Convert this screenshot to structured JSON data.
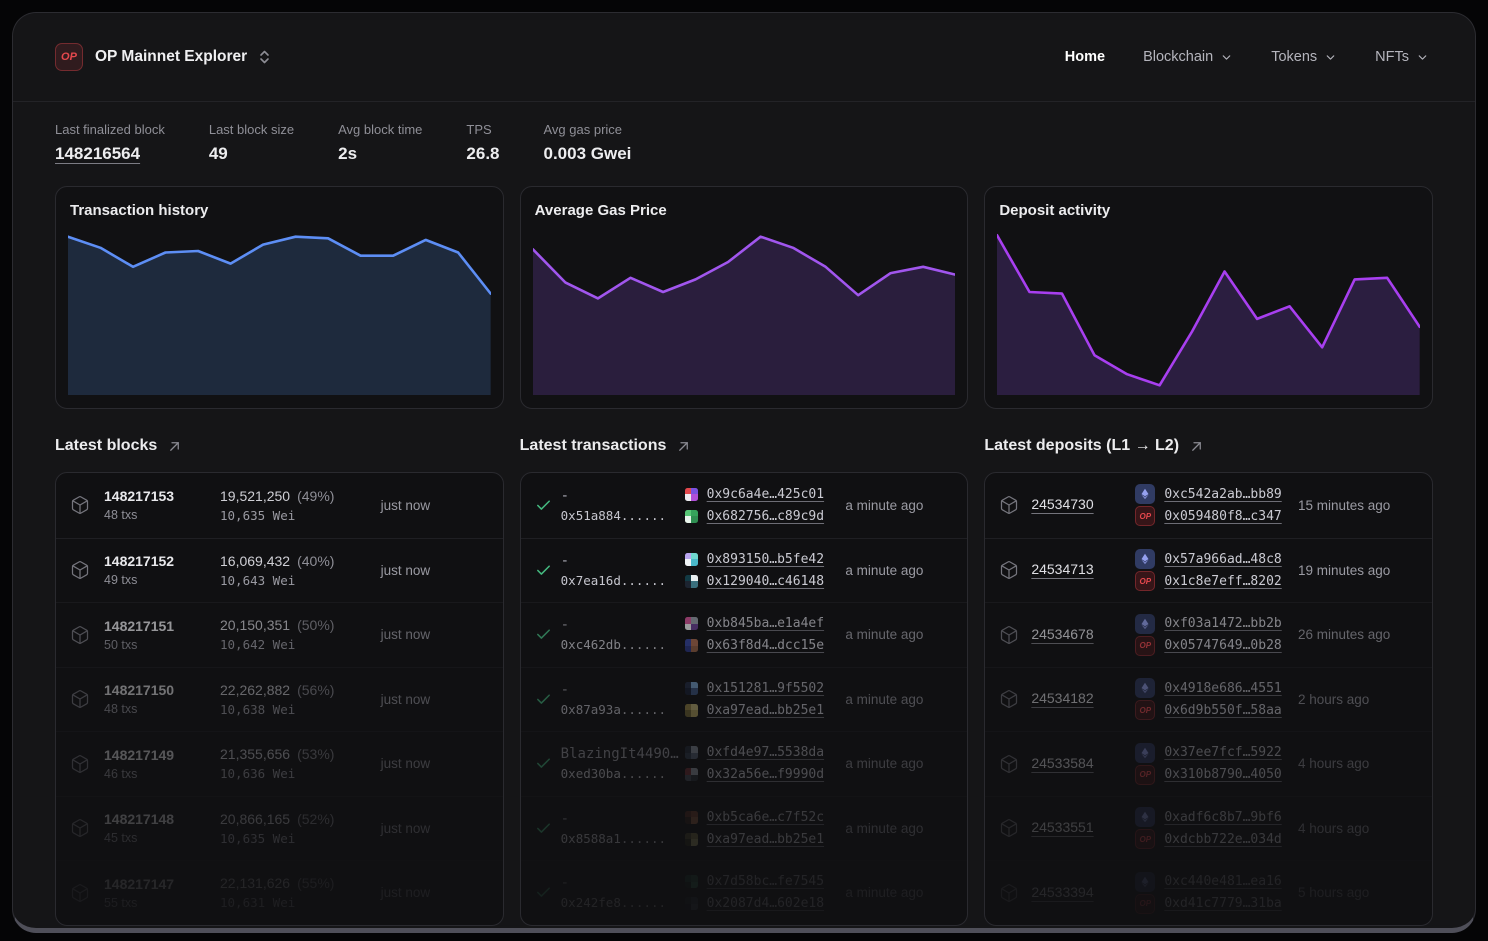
{
  "header": {
    "logo_text": "OP",
    "title": "OP Mainnet Explorer",
    "nav": [
      {
        "label": "Home",
        "active": true,
        "dropdown": false
      },
      {
        "label": "Blockchain",
        "active": false,
        "dropdown": true
      },
      {
        "label": "Tokens",
        "active": false,
        "dropdown": true
      },
      {
        "label": "NFTs",
        "active": false,
        "dropdown": true
      }
    ]
  },
  "stats": [
    {
      "label": "Last finalized block",
      "value": "148216564",
      "link": true
    },
    {
      "label": "Last block size",
      "value": "49",
      "link": false
    },
    {
      "label": "Avg block time",
      "value": "2s",
      "link": false
    },
    {
      "label": "TPS",
      "value": "26.8",
      "link": false
    },
    {
      "label": "Avg gas price",
      "value": "0.003 Gwei",
      "link": false
    }
  ],
  "chart_data": [
    {
      "type": "area",
      "title": "Transaction history",
      "x": [
        1,
        2,
        3,
        4,
        5,
        6,
        7,
        8,
        9,
        10,
        11,
        12,
        13,
        14
      ],
      "values": [
        97,
        90,
        78,
        87,
        88,
        80,
        92,
        97,
        96,
        85,
        85,
        95,
        87,
        61
      ],
      "ylim": [
        0,
        100
      ],
      "xlabel": "",
      "ylabel": "",
      "grid": false,
      "axes_hidden": true,
      "legend": "none",
      "line_color": "#5d8ef5",
      "fill_color": "#1e2a3d"
    },
    {
      "type": "area",
      "title": "Average Gas Price",
      "x": [
        1,
        2,
        3,
        4,
        5,
        6,
        7,
        8,
        9,
        10,
        11,
        12,
        13,
        14
      ],
      "values": [
        89,
        68,
        58,
        71,
        62,
        70,
        81,
        97,
        90,
        78,
        60,
        74,
        78,
        73
      ],
      "ylim": [
        0,
        100
      ],
      "xlabel": "",
      "ylabel": "",
      "grid": false,
      "axes_hidden": true,
      "legend": "none",
      "line_color": "#a156ee",
      "fill_color": "#2a1e3d"
    },
    {
      "type": "area",
      "title": "Deposit activity",
      "x": [
        1,
        2,
        3,
        4,
        5,
        6,
        7,
        8,
        9,
        10,
        11,
        12,
        13,
        14
      ],
      "values": [
        98,
        62,
        61,
        22,
        10,
        3,
        37,
        75,
        45,
        53,
        27,
        70,
        71,
        40
      ],
      "ylim": [
        0,
        100
      ],
      "xlabel": "",
      "ylabel": "",
      "grid": false,
      "axes_hidden": true,
      "legend": "none",
      "line_color": "#a83ff0",
      "fill_color": "#2b1e40"
    }
  ],
  "sections": {
    "blocks": {
      "title": "Latest blocks",
      "rows": [
        {
          "number": "148217153",
          "txs": "48 txs",
          "gas": "19,521,250",
          "gas_pct": "(49%)",
          "reward": "10,635 Wei",
          "time": "just now"
        },
        {
          "number": "148217152",
          "txs": "49 txs",
          "gas": "16,069,432",
          "gas_pct": "(40%)",
          "reward": "10,643 Wei",
          "time": "just now"
        },
        {
          "number": "148217151",
          "txs": "50 txs",
          "gas": "20,150,351",
          "gas_pct": "(50%)",
          "reward": "10,642 Wei",
          "time": "just now"
        },
        {
          "number": "148217150",
          "txs": "48 txs",
          "gas": "22,262,882",
          "gas_pct": "(56%)",
          "reward": "10,638 Wei",
          "time": "just now"
        },
        {
          "number": "148217149",
          "txs": "46 txs",
          "gas": "21,355,656",
          "gas_pct": "(53%)",
          "reward": "10,636 Wei",
          "time": "just now"
        },
        {
          "number": "148217148",
          "txs": "45 txs",
          "gas": "20,866,165",
          "gas_pct": "(52%)",
          "reward": "10,635 Wei",
          "time": "just now"
        },
        {
          "number": "148217147",
          "txs": "55 txs",
          "gas": "22,131,626",
          "gas_pct": "(55%)",
          "reward": "10,631 Wei",
          "time": "just now"
        }
      ]
    },
    "transactions": {
      "title": "Latest transactions",
      "rows": [
        {
          "method": "-",
          "hash": "0x51a884......",
          "from": "0x9c6a4e…425c01",
          "to": "0x682756…c89c9d",
          "time": "a minute ago",
          "from_colors": [
            "#e2484d",
            "#7b51e0",
            "#ececf0",
            "#b14fd8"
          ],
          "to_colors": [
            "#57c776",
            "#36a35c",
            "#e9f5ec",
            "#2f8f52"
          ]
        },
        {
          "method": "-",
          "hash": "0x7ea16d......",
          "from": "0x893150…b5fe42",
          "to": "0x129040…c46148",
          "time": "a minute ago",
          "from_colors": [
            "#b9a5ef",
            "#6fd8cf",
            "#f0f3f6",
            "#49b8c9"
          ],
          "to_colors": [
            "#123a44",
            "#e8eef0",
            "#1c2430",
            "#3a6f7c"
          ]
        },
        {
          "method": "-",
          "hash": "0xc462db......",
          "from": "0xb845ba…e1a4ef",
          "to": "0x63f8d4…dcc15e",
          "time": "a minute ago",
          "from_colors": [
            "#d8569c",
            "#9aa0ab",
            "#f3f3f5",
            "#6a3f93"
          ],
          "to_colors": [
            "#32439a",
            "#a6684c",
            "#27337a",
            "#8a5a40"
          ]
        },
        {
          "method": "-",
          "hash": "0x87a93a......",
          "from": "0x151281…9f5502",
          "to": "0xa97ead…bb25e1",
          "time": "a minute ago",
          "from_colors": [
            "#25304b",
            "#84b4e4",
            "#172037",
            "#3f5b88"
          ],
          "to_colors": [
            "#958443",
            "#c5b878",
            "#6e6231",
            "#ab9c5a"
          ]
        },
        {
          "method": "BlazingIt4490…",
          "hash": "0xed30ba......",
          "from": "0xfd4e97…5538da",
          "to": "0x32a56e…f9990d",
          "time": "a minute ago",
          "from_colors": [
            "#242e3d",
            "#97a0ae",
            "#313d4f",
            "#5a6678"
          ],
          "to_colors": [
            "#6e2e31",
            "#9096a0",
            "#434a54",
            "#282d35"
          ]
        },
        {
          "method": "-",
          "hash": "0x8588a1......",
          "from": "0xb5ca6e…c7f52c",
          "to": "0xa97ead…bb25e1",
          "time": "a minute ago",
          "from_colors": [
            "#5a2c22",
            "#7c432f",
            "#33201a",
            "#93603f"
          ],
          "to_colors": [
            "#46422a",
            "#736d41",
            "#2a2818",
            "#918a5c"
          ]
        },
        {
          "method": "-",
          "hash": "0x242fe8......",
          "from": "0x7d58bc…fe7545",
          "to": "0x2087d4…602e18",
          "time": "a minute ago",
          "from_colors": [
            "#1f4a3a",
            "#2f6b52",
            "#12291f",
            "#3f8263"
          ],
          "to_colors": [
            "#20262e",
            "#333c46",
            "#141920",
            "#434f5c"
          ]
        }
      ]
    },
    "deposits": {
      "title": "Latest deposits (L1 → L2)",
      "rows": [
        {
          "block": "24534730",
          "l1_tx": "0xc542a2ab…bb89",
          "l2_tx": "0x059480f8…c347",
          "time": "15 minutes ago"
        },
        {
          "block": "24534713",
          "l1_tx": "0x57a966ad…48c8",
          "l2_tx": "0x1c8e7eff…8202",
          "time": "19 minutes ago"
        },
        {
          "block": "24534678",
          "l1_tx": "0xf03a1472…bb2b",
          "l2_tx": "0x05747649…0b28",
          "time": "26 minutes ago"
        },
        {
          "block": "24534182",
          "l1_tx": "0x4918e686…4551",
          "l2_tx": "0x6d9b550f…58aa",
          "time": "2 hours ago"
        },
        {
          "block": "24533584",
          "l1_tx": "0x37ee7fcf…5922",
          "l2_tx": "0x310b8790…4050",
          "time": "4 hours ago"
        },
        {
          "block": "24533551",
          "l1_tx": "0xadf6c8b7…9bf6",
          "l2_tx": "0xdcbb722e…034d",
          "time": "4 hours ago"
        },
        {
          "block": "24533394",
          "l1_tx": "0xc440e481…ea16",
          "l2_tx": "0xd41c7779…31ba",
          "time": "5 hours ago"
        }
      ]
    }
  },
  "colors": {
    "accent_red": "#e5484d",
    "accent_green": "#44b97f",
    "chart_blue": "#5d8ef5",
    "chart_purple": "#a156ee",
    "chart_magenta": "#a83ff0",
    "eth_badge_bg": "#303b63",
    "eth_badge_glyph": "#9aa5f5"
  }
}
